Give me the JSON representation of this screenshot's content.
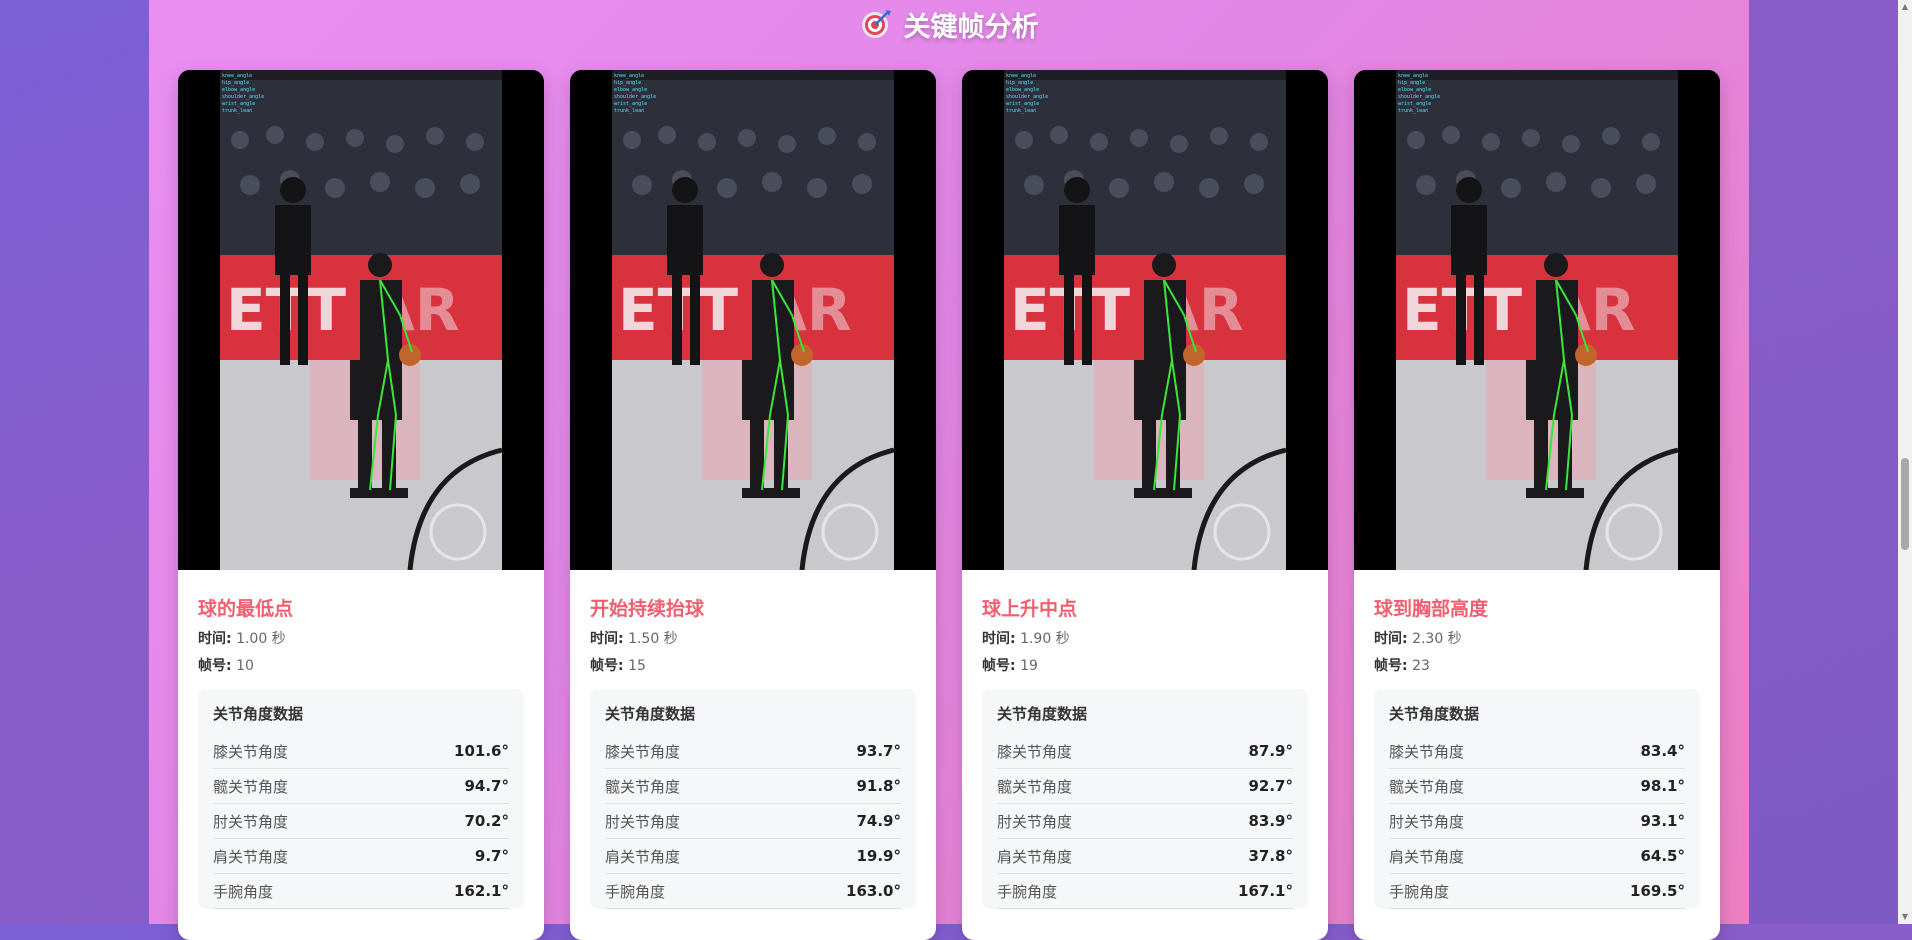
{
  "section": {
    "icon": "target-icon",
    "title": "关键帧分析"
  },
  "cards": [
    {
      "title": "球的最低点",
      "time_label": "时间:",
      "time_value": "1.00 秒",
      "frame_label": "帧号:",
      "frame_value": "10",
      "angles_title": "关节角度数据",
      "angles": [
        {
          "label": "膝关节角度",
          "value": "101.6°"
        },
        {
          "label": "髋关节角度",
          "value": "94.7°"
        },
        {
          "label": "肘关节角度",
          "value": "70.2°"
        },
        {
          "label": "肩关节角度",
          "value": "9.7°"
        },
        {
          "label": "手腕角度",
          "value": "162.1°"
        }
      ]
    },
    {
      "title": "开始持续抬球",
      "time_label": "时间:",
      "time_value": "1.50 秒",
      "frame_label": "帧号:",
      "frame_value": "15",
      "angles_title": "关节角度数据",
      "angles": [
        {
          "label": "膝关节角度",
          "value": "93.7°"
        },
        {
          "label": "髋关节角度",
          "value": "91.8°"
        },
        {
          "label": "肘关节角度",
          "value": "74.9°"
        },
        {
          "label": "肩关节角度",
          "value": "19.9°"
        },
        {
          "label": "手腕角度",
          "value": "163.0°"
        }
      ]
    },
    {
      "title": "球上升中点",
      "time_label": "时间:",
      "time_value": "1.90 秒",
      "frame_label": "帧号:",
      "frame_value": "19",
      "angles_title": "关节角度数据",
      "angles": [
        {
          "label": "膝关节角度",
          "value": "87.9°"
        },
        {
          "label": "髋关节角度",
          "value": "92.7°"
        },
        {
          "label": "肘关节角度",
          "value": "83.9°"
        },
        {
          "label": "肩关节角度",
          "value": "37.8°"
        },
        {
          "label": "手腕角度",
          "value": "167.1°"
        }
      ]
    },
    {
      "title": "球到胸部高度",
      "time_label": "时间:",
      "time_value": "2.30 秒",
      "frame_label": "帧号:",
      "frame_value": "23",
      "angles_title": "关节角度数据",
      "angles": [
        {
          "label": "膝关节角度",
          "value": "83.4°"
        },
        {
          "label": "髋关节角度",
          "value": "98.1°"
        },
        {
          "label": "肘关节角度",
          "value": "93.1°"
        },
        {
          "label": "肩关节角度",
          "value": "64.5°"
        },
        {
          "label": "手腕角度",
          "value": "169.5°"
        }
      ]
    }
  ],
  "colors": {
    "accent": "#ef5f6f",
    "skeleton": "#39e639"
  }
}
